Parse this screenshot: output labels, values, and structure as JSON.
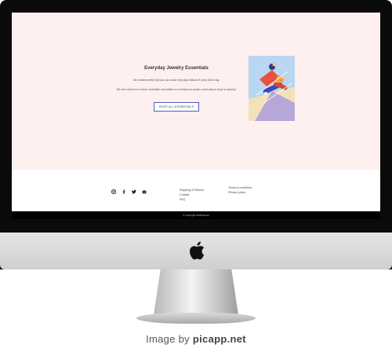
{
  "hero": {
    "title": "Everyday Jewelry Essentials",
    "paragraph_1": "We create jewelry that you can wear everyday instead of every other day.",
    "paragraph_2": "We are a bunch of curious 'scientists' and artists on a mission to create a new way to shop for jewelry.",
    "button_label": "SHOP ALL ESSENTIALS",
    "background_color": "#fdf0ef",
    "button_border_color": "#4a5fc1"
  },
  "footer": {
    "social_icons": [
      "instagram-icon",
      "facebook-icon",
      "twitter-icon",
      "youtube-icon"
    ],
    "links_col_1": [
      "Shipping & Returns",
      "Contact",
      "FAQ"
    ],
    "links_col_2": [
      "Terms & conditions",
      "Privacy policy"
    ],
    "copyright": "© Copyright 2018 Stones"
  },
  "watermark": {
    "prefix": "Image by",
    "site": "picapp.net"
  }
}
